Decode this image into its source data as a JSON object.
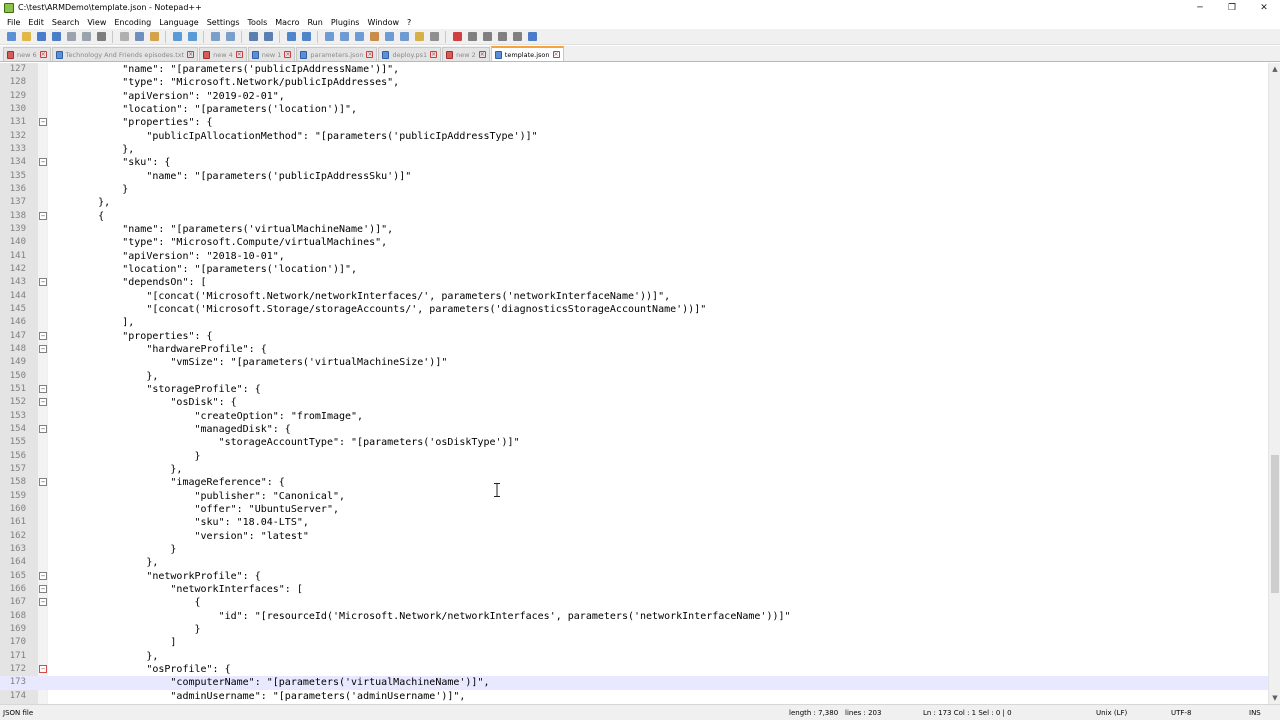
{
  "window": {
    "title": "C:\\test\\ARMDemo\\template.json - Notepad++",
    "minimize_glyph": "─",
    "restore_glyph": "❐",
    "close_glyph": "✕"
  },
  "menu": [
    "File",
    "Edit",
    "Search",
    "View",
    "Encoding",
    "Language",
    "Settings",
    "Tools",
    "Macro",
    "Run",
    "Plugins",
    "Window",
    "?"
  ],
  "toolbar": {
    "icons": [
      "new-file-icon",
      "open-file-icon",
      "save-icon",
      "save-all-icon",
      "close-icon",
      "close-all-icon",
      "print-icon",
      "cut-icon",
      "copy-icon",
      "paste-icon",
      "undo-icon",
      "redo-icon",
      "find-icon",
      "replace-icon",
      "zoom-in-icon",
      "zoom-out-icon",
      "sync-v-icon",
      "sync-h-icon",
      "word-wrap-icon",
      "show-all-chars-icon",
      "indent-guide-icon",
      "udl-icon",
      "doc-map-icon",
      "function-list-icon",
      "folder-workspace-icon",
      "monitoring-icon",
      "record-macro-icon",
      "stop-record-icon",
      "play-macro-icon",
      "run-macro-multiple-icon",
      "save-macro-icon",
      "spellcheck-icon"
    ],
    "accent": "#4a7cc9"
  },
  "tabs": [
    {
      "label": "new 6",
      "active": false,
      "modified": true
    },
    {
      "label": "Technology And Friends episodes.txt",
      "active": false,
      "modified": false
    },
    {
      "label": "new 4",
      "active": false,
      "modified": true
    },
    {
      "label": "new 1",
      "active": false,
      "modified": false
    },
    {
      "label": "parameters.json",
      "active": false,
      "modified": false
    },
    {
      "label": "deploy.ps1",
      "active": false,
      "modified": false
    },
    {
      "label": "new 2",
      "active": false,
      "modified": true
    },
    {
      "label": "template.json",
      "active": true,
      "modified": false
    }
  ],
  "editor": {
    "current_line": 173,
    "lines": [
      {
        "n": "127",
        "code": "            \"name\": \"[parameters('publicIpAddressName')]\",",
        "fold": ""
      },
      {
        "n": "128",
        "code": "            \"type\": \"Microsoft.Network/publicIpAddresses\",",
        "fold": ""
      },
      {
        "n": "129",
        "code": "            \"apiVersion\": \"2019-02-01\",",
        "fold": ""
      },
      {
        "n": "130",
        "code": "            \"location\": \"[parameters('location')]\",",
        "fold": ""
      },
      {
        "n": "131",
        "code": "            \"properties\": {",
        "fold": "minus"
      },
      {
        "n": "132",
        "code": "                \"publicIpAllocationMethod\": \"[parameters('publicIpAddressType')]\"",
        "fold": ""
      },
      {
        "n": "133",
        "code": "            },",
        "fold": ""
      },
      {
        "n": "134",
        "code": "            \"sku\": {",
        "fold": "minus"
      },
      {
        "n": "135",
        "code": "                \"name\": \"[parameters('publicIpAddressSku')]\"",
        "fold": ""
      },
      {
        "n": "136",
        "code": "            }",
        "fold": ""
      },
      {
        "n": "137",
        "code": "        },",
        "fold": ""
      },
      {
        "n": "138",
        "code": "        {",
        "fold": "minus"
      },
      {
        "n": "139",
        "code": "            \"name\": \"[parameters('virtualMachineName')]\",",
        "fold": ""
      },
      {
        "n": "140",
        "code": "            \"type\": \"Microsoft.Compute/virtualMachines\",",
        "fold": ""
      },
      {
        "n": "141",
        "code": "            \"apiVersion\": \"2018-10-01\",",
        "fold": ""
      },
      {
        "n": "142",
        "code": "            \"location\": \"[parameters('location')]\",",
        "fold": ""
      },
      {
        "n": "143",
        "code": "            \"dependsOn\": [",
        "fold": "minus"
      },
      {
        "n": "144",
        "code": "                \"[concat('Microsoft.Network/networkInterfaces/', parameters('networkInterfaceName'))]\",",
        "fold": ""
      },
      {
        "n": "145",
        "code": "                \"[concat('Microsoft.Storage/storageAccounts/', parameters('diagnosticsStorageAccountName'))]\"",
        "fold": ""
      },
      {
        "n": "146",
        "code": "            ],",
        "fold": ""
      },
      {
        "n": "147",
        "code": "            \"properties\": {",
        "fold": "minus"
      },
      {
        "n": "148",
        "code": "                \"hardwareProfile\": {",
        "fold": "minus"
      },
      {
        "n": "149",
        "code": "                    \"vmSize\": \"[parameters('virtualMachineSize')]\"",
        "fold": ""
      },
      {
        "n": "150",
        "code": "                },",
        "fold": ""
      },
      {
        "n": "151",
        "code": "                \"storageProfile\": {",
        "fold": "minus"
      },
      {
        "n": "152",
        "code": "                    \"osDisk\": {",
        "fold": "minus"
      },
      {
        "n": "153",
        "code": "                        \"createOption\": \"fromImage\",",
        "fold": ""
      },
      {
        "n": "154",
        "code": "                        \"managedDisk\": {",
        "fold": "minus"
      },
      {
        "n": "155",
        "code": "                            \"storageAccountType\": \"[parameters('osDiskType')]\"",
        "fold": ""
      },
      {
        "n": "156",
        "code": "                        }",
        "fold": ""
      },
      {
        "n": "157",
        "code": "                    },",
        "fold": ""
      },
      {
        "n": "158",
        "code": "                    \"imageReference\": {",
        "fold": "minus"
      },
      {
        "n": "159",
        "code": "                        \"publisher\": \"Canonical\",",
        "fold": ""
      },
      {
        "n": "160",
        "code": "                        \"offer\": \"UbuntuServer\",",
        "fold": ""
      },
      {
        "n": "161",
        "code": "                        \"sku\": \"18.04-LTS\",",
        "fold": ""
      },
      {
        "n": "162",
        "code": "                        \"version\": \"latest\"",
        "fold": ""
      },
      {
        "n": "163",
        "code": "                    }",
        "fold": ""
      },
      {
        "n": "164",
        "code": "                },",
        "fold": ""
      },
      {
        "n": "165",
        "code": "                \"networkProfile\": {",
        "fold": "minus"
      },
      {
        "n": "166",
        "code": "                    \"networkInterfaces\": [",
        "fold": "minus"
      },
      {
        "n": "167",
        "code": "                        {",
        "fold": "minus"
      },
      {
        "n": "168",
        "code": "                            \"id\": \"[resourceId('Microsoft.Network/networkInterfaces', parameters('networkInterfaceName'))]\"",
        "fold": ""
      },
      {
        "n": "169",
        "code": "                        }",
        "fold": ""
      },
      {
        "n": "170",
        "code": "                    ]",
        "fold": ""
      },
      {
        "n": "171",
        "code": "                },",
        "fold": ""
      },
      {
        "n": "172",
        "code": "                \"osProfile\": {",
        "fold": "minus-red"
      },
      {
        "n": "173",
        "code": "                    \"computerName\": \"[parameters('virtualMachineName')]\",",
        "fold": ""
      },
      {
        "n": "174",
        "code": "                    \"adminUsername\": \"[parameters('adminUsername')]\",",
        "fold": ""
      }
    ]
  },
  "scrollbar": {
    "up_glyph": "▲",
    "down_glyph": "▼"
  },
  "status": {
    "file_type": "JSON file",
    "length": "length : 7,380",
    "lines": "lines : 203",
    "position": "Ln : 173    Col : 1    Sel : 0 | 0",
    "eol": "Unix (LF)",
    "encoding": "UTF-8",
    "mode": "INS"
  }
}
